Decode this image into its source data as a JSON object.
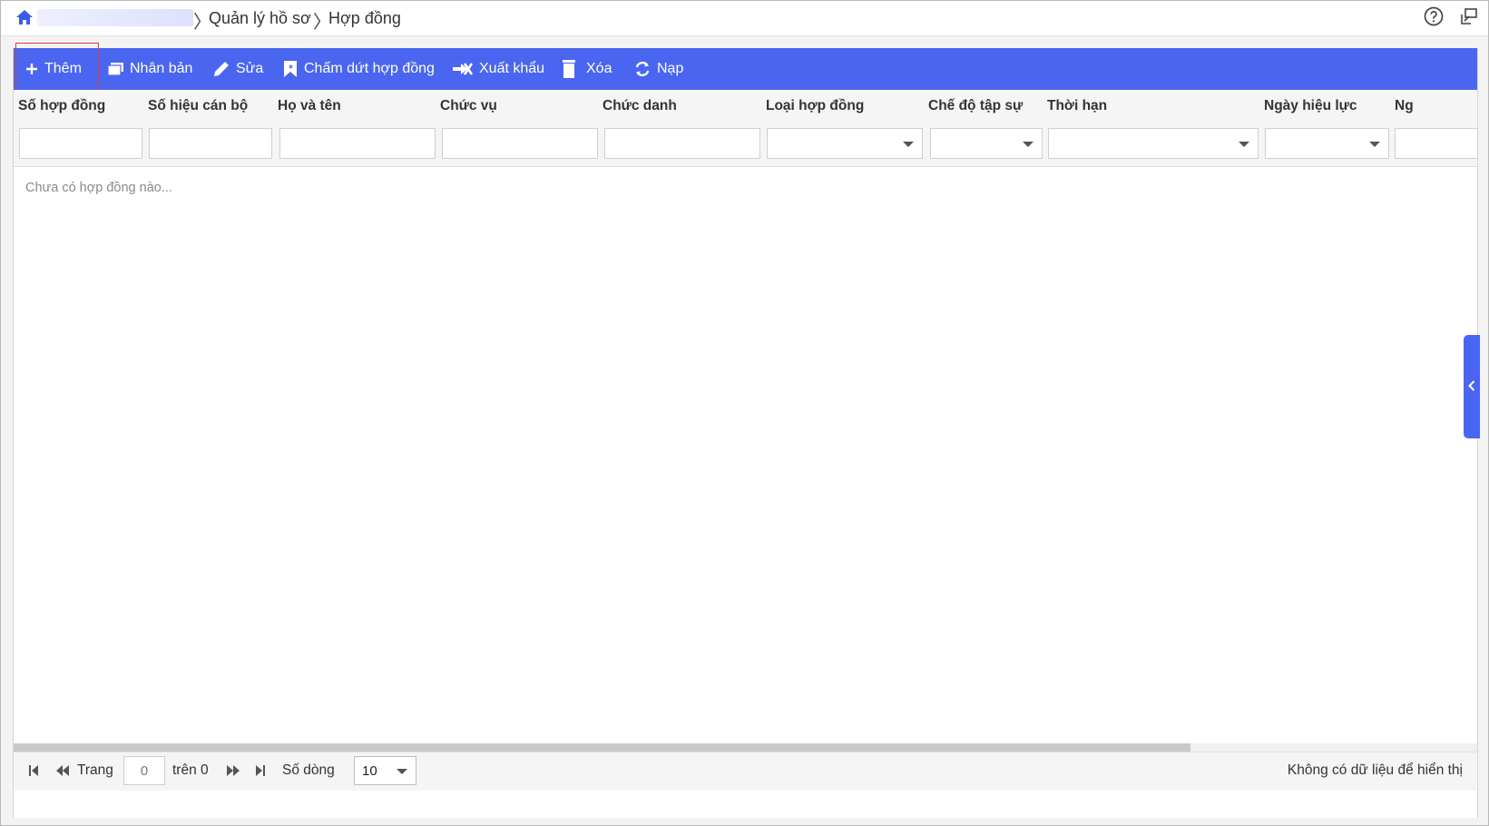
{
  "breadcrumb": {
    "items": [
      "Quản lý hồ sơ",
      "Hợp đồng"
    ]
  },
  "toolbar": {
    "add": "Thêm",
    "duplicate": "Nhân bản",
    "edit": "Sửa",
    "terminate": "Chấm dứt hợp đồng",
    "export": "Xuất khẩu",
    "delete": "Xóa",
    "reload": "Nạp"
  },
  "columns": [
    "Số hợp đồng",
    "Số hiệu cán bộ",
    "Họ và tên",
    "Chức vụ",
    "Chức danh",
    "Loại hợp đồng",
    "Chế độ tập sự",
    "Thời hạn",
    "Ngày hiệu lực",
    "Ng"
  ],
  "empty_message": "Chưa có hợp đồng nào...",
  "pager": {
    "page_label": "Trang",
    "page_value": "0",
    "of_label": "trên 0",
    "rows_label": "Số dòng",
    "rows_value": "10",
    "status": "Không có dữ liệu để hiển thị"
  },
  "colors": {
    "accent": "#4a66f0",
    "highlight": "#e53935"
  },
  "icons": {
    "home": "home-icon",
    "help": "help-icon",
    "window": "window-icon",
    "add": "plus-icon",
    "duplicate": "copy-icon",
    "edit": "pencil-icon",
    "terminate": "bookmark-icon",
    "export": "export-icon",
    "delete": "trash-icon",
    "reload": "refresh-icon"
  }
}
